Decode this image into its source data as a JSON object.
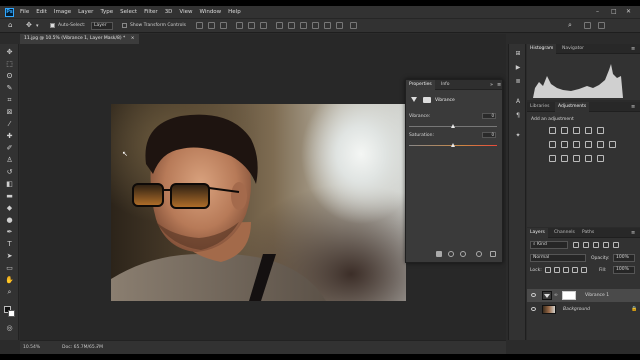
{
  "menubar": {
    "logo": "Ps",
    "items": [
      "File",
      "Edit",
      "Image",
      "Layer",
      "Type",
      "Select",
      "Filter",
      "3D",
      "View",
      "Window",
      "Help"
    ],
    "window_controls": [
      "–",
      "□",
      "✕"
    ]
  },
  "options_bar": {
    "auto_select_label": "Auto-Select:",
    "auto_select_value": "Layer",
    "transform_label": "Show Transform Controls"
  },
  "document": {
    "tab_title": "11.jpg @ 10.5% (Vibrance 1, Layer Mask/8) *",
    "zoom": "10.54%",
    "doc_info": "Doc: 65.7M/65.7M"
  },
  "properties_panel": {
    "tabs": [
      "Properties",
      "Info"
    ],
    "section_title": "Vibrance",
    "vibrance_label": "Vibrance:",
    "vibrance_value": "0",
    "vibrance_level": 0.5,
    "saturation_label": "Saturation:",
    "saturation_value": "0",
    "saturation_level": 0.5
  },
  "histogram_panel": {
    "tabs": [
      "Histogram",
      "Navigator"
    ]
  },
  "adjustments_panel": {
    "tabs": [
      "Libraries",
      "Adjustments"
    ],
    "add_label": "Add an adjustment"
  },
  "layers_panel": {
    "tabs": [
      "Layers",
      "Channels",
      "Paths"
    ],
    "filter_label": "Kind",
    "blend_mode": "Normal",
    "opacity_label": "Opacity:",
    "opacity_value": "100%",
    "lock_label": "Lock:",
    "fill_label": "Fill:",
    "fill_value": "100%",
    "layers": [
      {
        "name": "Vibrance 1"
      },
      {
        "name": "Background"
      }
    ]
  },
  "colors": {
    "app_bg": "#2b2b2b",
    "panel_bg": "#323232",
    "accent": "#31a8ff"
  }
}
